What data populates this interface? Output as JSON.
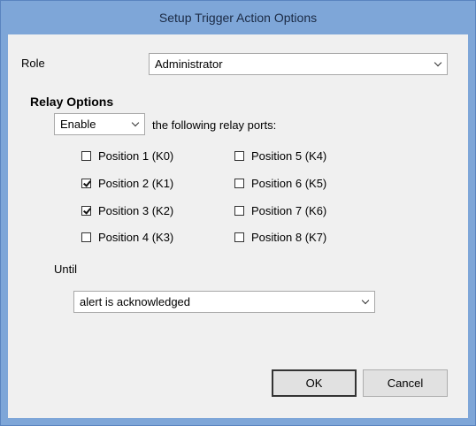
{
  "window": {
    "title": "Setup Trigger Action Options"
  },
  "role": {
    "label": "Role",
    "value": "Administrator"
  },
  "relay": {
    "heading": "Relay Options",
    "mode_value": "Enable",
    "suffix": "the following relay ports:",
    "positions": [
      {
        "label": "Position 1 (K0)",
        "checked": false
      },
      {
        "label": "Position 2 (K1)",
        "checked": true
      },
      {
        "label": "Position 3 (K2)",
        "checked": true
      },
      {
        "label": "Position 4 (K3)",
        "checked": false
      },
      {
        "label": "Position 5 (K4)",
        "checked": false
      },
      {
        "label": "Position 6 (K5)",
        "checked": false
      },
      {
        "label": "Position 7 (K6)",
        "checked": false
      },
      {
        "label": "Position 8 (K7)",
        "checked": false
      }
    ]
  },
  "until": {
    "label": "Until",
    "value": "alert is acknowledged"
  },
  "buttons": {
    "ok": "OK",
    "cancel": "Cancel"
  }
}
